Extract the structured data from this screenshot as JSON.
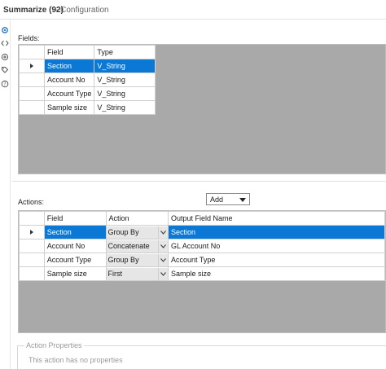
{
  "header": {
    "tool_name": "Summarize (92)",
    "separator_text": "- Configuration"
  },
  "side_icons": [
    "gear-icon",
    "code-icon",
    "config-icon",
    "tag-icon",
    "help-icon"
  ],
  "fields": {
    "label": "Fields:",
    "columns": [
      "Field",
      "Type"
    ],
    "rows": [
      {
        "field": "Section",
        "type": "V_String",
        "selected": true
      },
      {
        "field": "Account No",
        "type": "V_String",
        "selected": false
      },
      {
        "field": "Account Type",
        "type": "V_String",
        "selected": false
      },
      {
        "field": "Sample size",
        "type": "V_String",
        "selected": false
      }
    ]
  },
  "actions": {
    "label": "Actions:",
    "add_button": "Add",
    "columns": [
      "Field",
      "Action",
      "Output Field Name"
    ],
    "rows": [
      {
        "field": "Section",
        "action": "Group By",
        "output": "Section",
        "selected": true
      },
      {
        "field": "Account No",
        "action": "Concatenate",
        "output": "GL Account No",
        "selected": false
      },
      {
        "field": "Account Type",
        "action": "Group By",
        "output": "Account Type",
        "selected": false
      },
      {
        "field": "Sample size",
        "action": "First",
        "output": "Sample size",
        "selected": false
      }
    ]
  },
  "action_properties": {
    "legend": "Action Properties",
    "message": "This action has no properties"
  },
  "colors": {
    "selection": "#0a78d4",
    "grid_background": "#a9a9a9"
  }
}
